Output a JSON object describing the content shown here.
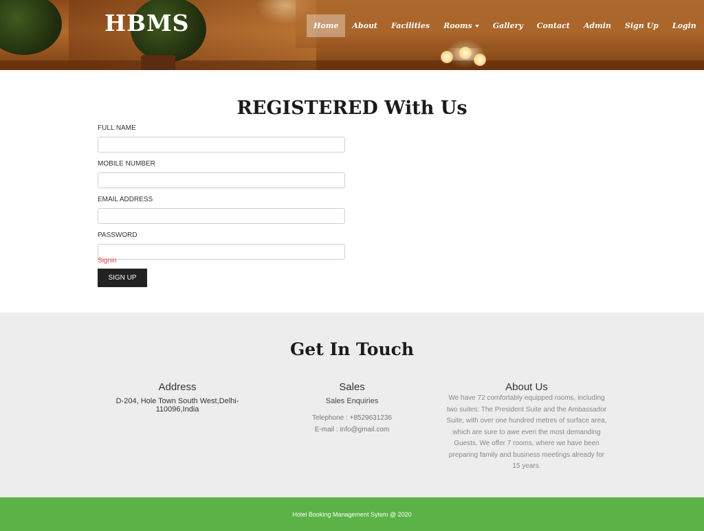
{
  "brand": {
    "logo": "HBMS"
  },
  "nav": {
    "items": [
      {
        "label": "Home",
        "active": true
      },
      {
        "label": "About"
      },
      {
        "label": "Facilities"
      },
      {
        "label": "Rooms",
        "dropdown": true
      },
      {
        "label": "Gallery"
      },
      {
        "label": "Contact"
      },
      {
        "label": "Admin"
      },
      {
        "label": "Sign Up"
      },
      {
        "label": "Login"
      }
    ]
  },
  "register": {
    "title": "REGISTERED With Us",
    "fields": {
      "full_name": {
        "label": "FULL NAME",
        "value": ""
      },
      "mobile": {
        "label": "MOBILE NUMBER",
        "value": ""
      },
      "email": {
        "label": "EMAIL ADDRESS",
        "value": ""
      },
      "password": {
        "label": "PASSWORD",
        "value": ""
      }
    },
    "signin_link": "Signin",
    "submit_label": "SIGN UP"
  },
  "contact": {
    "title": "Get In Touch",
    "address": {
      "heading": "Address",
      "text": "D-204, Hole Town South West,Delhi-110096,India"
    },
    "sales": {
      "heading": "Sales",
      "subheading": "Sales Enquiries",
      "telephone": "Telephone : +8529631236",
      "email": "E-mail : info@gmail.com"
    },
    "about": {
      "heading": "About Us",
      "text": "We have 72 comfortably equipped rooms, including two suites: The President Suite and the Ambassador Suite, with over one hundred metres of surface area, which are sure to awe even the most demanding Guests. We offer 7 rooms, where we have been preparing family and business meetings already for 15 years."
    }
  },
  "footer": {
    "text": "Hotel Booking Management Sytem @ 2020"
  },
  "colors": {
    "footer_green": "#5bb347",
    "button_dark": "#222222",
    "contact_bg": "#ededed",
    "signin_red": "#e23b3b"
  }
}
